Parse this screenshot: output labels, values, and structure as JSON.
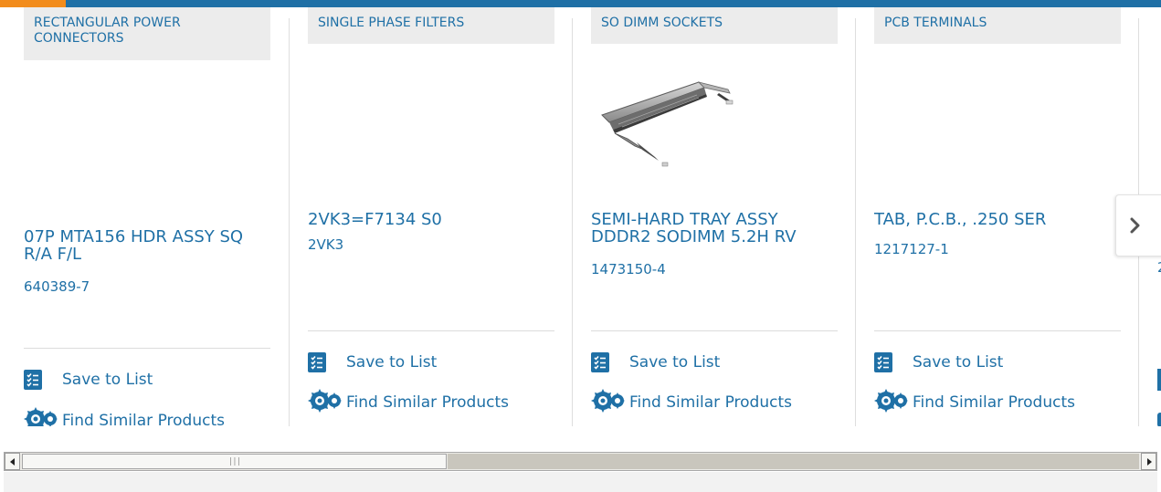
{
  "cards": [
    {
      "category": "RECTANGULAR POWER CONNECTORS",
      "title": "07P MTA156 HDR ASSY SQ R/A F/L",
      "part_number": "640389-7",
      "save_label": "Save to List",
      "find_label": "Find Similar Products"
    },
    {
      "category": "SINGLE PHASE FILTERS",
      "title": "2VK3=F7134 S0",
      "part_number": "2VK3",
      "save_label": "Save to List",
      "find_label": "Find Similar Products"
    },
    {
      "category": "SO DIMM SOCKETS",
      "title": "SEMI-HARD TRAY ASSY DDDR2 SODIMM 5.2H RV",
      "part_number": "1473150-4",
      "save_label": "Save to List",
      "find_label": "Find Similar Products"
    },
    {
      "category": "PCB TERMINALS",
      "title": "TAB, P.C.B., .250 SER",
      "part_number": "1217127-1",
      "save_label": "Save to List",
      "find_label": "Find Similar Products"
    }
  ],
  "partial_card": {
    "part_number_fragment": "2"
  },
  "icons": {
    "save": "checklist-icon",
    "find": "gears-icon",
    "next": "chevron-right-icon",
    "scroll_left": "arrow-left-icon",
    "scroll_right": "arrow-right-icon"
  },
  "colors": {
    "brand_blue": "#1f70a6",
    "accent_orange": "#f28c1c",
    "category_bg": "#ececec"
  }
}
